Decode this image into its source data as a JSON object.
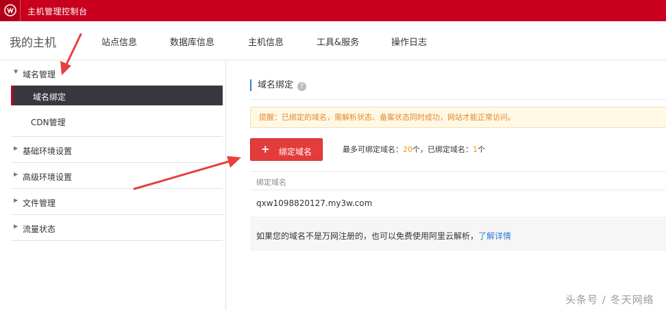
{
  "topbar": {
    "title": "主机管理控制台"
  },
  "nav": {
    "home": "我的主机",
    "items": [
      "站点信息",
      "数据库信息",
      "主机信息",
      "工具&服务",
      "操作日志"
    ]
  },
  "sidebar": {
    "group_domain": "域名管理",
    "sub_items": [
      "域名绑定",
      "CDN管理"
    ],
    "groups": [
      "基础环境设置",
      "高级环境设置",
      "文件管理",
      "流量状态"
    ]
  },
  "main": {
    "section_title": "域名绑定",
    "help_icon": "?",
    "notice": "提醒：已绑定的域名，需解析状态、备案状态同时成功，网站才能正常访问。",
    "bind_button": "绑定域名",
    "limit_prefix": "最多可绑定域名：",
    "limit_max": "20",
    "limit_mid": "个，已绑定域名：",
    "limit_used": "1",
    "limit_suffix": "个",
    "table_header": "绑定域名",
    "domains": [
      "qxw1098820127.my3w.com"
    ],
    "footnote_text": "如果您的域名不是万网注册的，也可以免费使用阿里云解析，",
    "footnote_link": "了解详情"
  },
  "watermark": "头条号 / 冬天网络",
  "colors": {
    "brand_red": "#c8001e",
    "button_red": "#e43c3c",
    "link_blue": "#2f7bd9",
    "notice_orange": "#e2892c",
    "count_orange": "#f39800",
    "annotation_arrow": "#e8403c"
  }
}
